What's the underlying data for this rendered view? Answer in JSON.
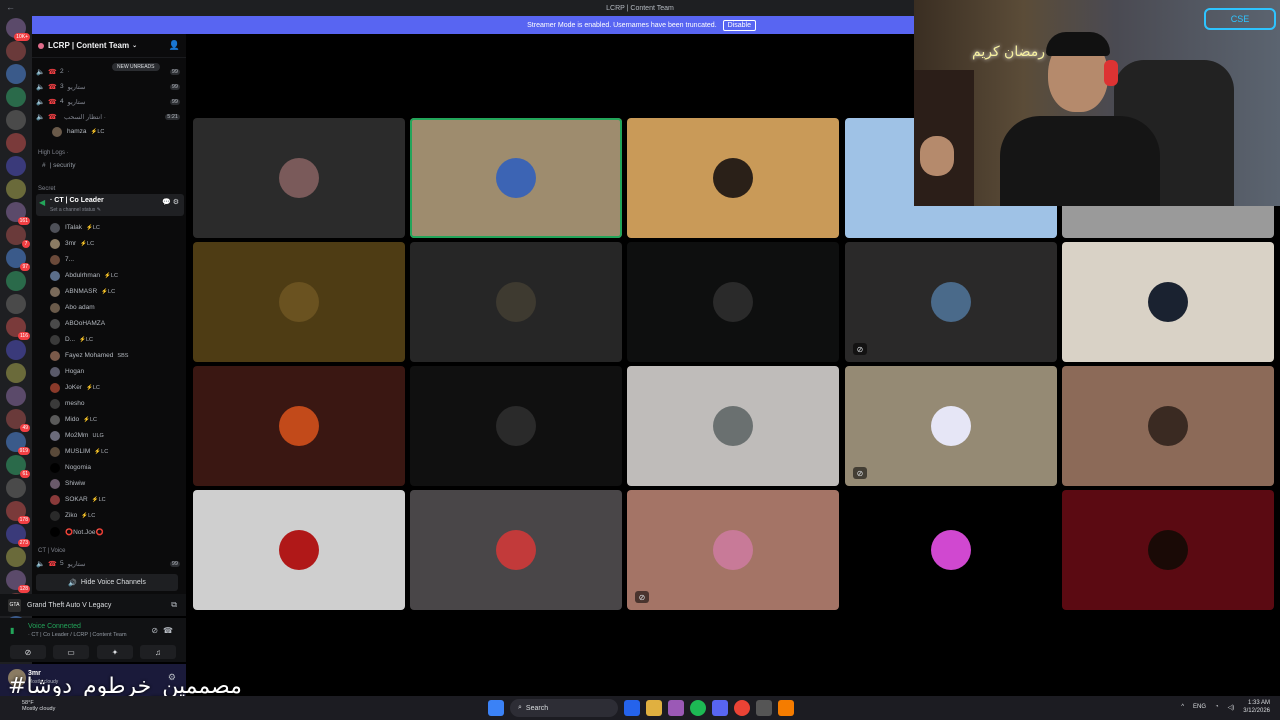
{
  "window": {
    "title": "LCRP | Content Team",
    "back_glyph": "←"
  },
  "banner": {
    "text": "Streamer Mode is enabled. Usernames have been truncated.",
    "button": "Disable"
  },
  "rail": {
    "badges": [
      "10K+",
      "",
      "",
      "",
      "",
      "",
      "",
      "",
      "161",
      "7",
      "97",
      "",
      "",
      "116",
      "",
      "",
      "",
      "49",
      "919",
      "61",
      "",
      "178",
      "273",
      "",
      "128",
      "10",
      "TKG",
      "NEW"
    ]
  },
  "server": {
    "name": "LCRP | Content Team",
    "chevron": "⌄",
    "invite_icon": "👤"
  },
  "channels": {
    "voice_top": [
      {
        "num": "2",
        "label": "·",
        "count": "99"
      },
      {
        "num": "3",
        "label": "ستاريو",
        "count": "99"
      },
      {
        "num": "4",
        "label": "ستاريو",
        "count": "99"
      },
      {
        "num": "",
        "label": "انتظار السحب ·",
        "count": "5:21"
      }
    ],
    "new_unreads": "NEW UNREADS",
    "hamza": {
      "name": "hamza",
      "tag": "⚡LC"
    },
    "high_logs": "High Logs ·",
    "security": "| security",
    "secret": "Secret",
    "active": {
      "title": "· CT | Co Leader",
      "sub": "Set a channel status ✎",
      "actions": "💬⚙"
    },
    "members": [
      {
        "name": "ITalak",
        "tag": "⚡LC",
        "color": "#4e5058"
      },
      {
        "name": "3mr",
        "tag": "⚡LC",
        "color": "#8a7b63"
      },
      {
        "name": "7...",
        "tag": "",
        "color": "#6b4a3a"
      },
      {
        "name": "Abdulrhman",
        "tag": "⚡LC",
        "color": "#5b6e8a"
      },
      {
        "name": "ABNMASR",
        "tag": "⚡LC",
        "color": "#7a6a5a"
      },
      {
        "name": "Abo adam",
        "tag": "",
        "color": "#6a5a4a"
      },
      {
        "name": "ABOoHAMZA",
        "tag": "",
        "color": "#4a4a4a"
      },
      {
        "name": "D...",
        "tag": "⚡LC",
        "color": "#3a3a3a"
      },
      {
        "name": "Fayez Mohamed",
        "tag": "SBS",
        "color": "#7a5a4a"
      },
      {
        "name": "Hogan",
        "tag": "",
        "color": "#5a5a6a"
      },
      {
        "name": "JoKer",
        "tag": "⚡LC",
        "color": "#8a3a2a"
      },
      {
        "name": "mesho",
        "tag": "",
        "color": "#3a3a3a"
      },
      {
        "name": "Mido",
        "tag": "⚡LC",
        "color": "#5a5a5a"
      },
      {
        "name": "Mo2Mm",
        "tag": "ULG",
        "color": "#6a6a7a"
      },
      {
        "name": "MUSLIM",
        "tag": "⚡LC",
        "color": "#5a4a3a"
      },
      {
        "name": "Nogomia",
        "tag": "",
        "color": "#000000"
      },
      {
        "name": "Shiwiw",
        "tag": "",
        "color": "#6a5a6a"
      },
      {
        "name": "SOKAR",
        "tag": "⚡LC",
        "color": "#8a3a3a"
      },
      {
        "name": "Ziko",
        "tag": "⚡LC",
        "color": "#2a2a2a"
      },
      {
        "name": "⭕Not.Joe⭕",
        "tag": "",
        "color": "#000000"
      }
    ],
    "ct_voice": "CT | Voice",
    "voice_bottom": {
      "num": "5",
      "label": "ستاريو",
      "count": "99"
    },
    "hide_voice": "Hide Voice Channels"
  },
  "activity": {
    "icon_text": "GTA",
    "name": "Grand Theft Auto V Legacy"
  },
  "voice": {
    "title": "Voice Connected",
    "sub": "· CT | Co Leader / LCRP | Content Team"
  },
  "user": {
    "name": "3mr",
    "status": "Mostly cloudy"
  },
  "tiles": [
    {
      "bg": "#2b2b2b",
      "ava": "#7a5a5a",
      "muted": false,
      "speaking": false
    },
    {
      "bg": "#9e8c6e",
      "ava": "#3c64b4",
      "muted": false,
      "speaking": true
    },
    {
      "bg": "#c99a58",
      "ava": "#2a2018",
      "muted": false,
      "speaking": false
    },
    {
      "bg": "#9fc2e6",
      "ava": "#9fc2e6",
      "muted": false,
      "speaking": false
    },
    {
      "bg": "#9a9a9a",
      "ava": "#9a9a9a",
      "muted": false,
      "speaking": false
    },
    {
      "bg": "#4e3c14",
      "ava": "#6a5220",
      "muted": false,
      "speaking": false
    },
    {
      "bg": "#262626",
      "ava": "#3e3a30",
      "muted": false,
      "speaking": false
    },
    {
      "bg": "#0e0f0f",
      "ava": "#2a2a2a",
      "muted": false,
      "speaking": false
    },
    {
      "bg": "#2a2929",
      "ava": "#4a6a8a",
      "muted": true,
      "speaking": false
    },
    {
      "bg": "#d9d2c6",
      "ava": "#1a2230",
      "muted": false,
      "speaking": false
    },
    {
      "bg": "#3a1712",
      "ava": "#c24a1a",
      "muted": false,
      "speaking": false
    },
    {
      "bg": "#101010",
      "ava": "#2a2a2a",
      "muted": false,
      "speaking": false
    },
    {
      "bg": "#bfbcba",
      "ava": "#6a7070",
      "muted": false,
      "speaking": false
    },
    {
      "bg": "#958a74",
      "ava": "#e6e6f6",
      "muted": true,
      "speaking": false
    },
    {
      "bg": "#8c6a58",
      "ava": "#3a2a22",
      "muted": false,
      "speaking": false
    },
    {
      "bg": "#cfcfcf",
      "ava": "#b01818",
      "muted": false,
      "speaking": false
    },
    {
      "bg": "#494648",
      "ava": "#c23a3a",
      "muted": false,
      "speaking": false
    },
    {
      "bg": "#a47466",
      "ava": "#c87a98",
      "muted": true,
      "speaking": false
    },
    {
      "bg": "#000000",
      "ava": "#d048d0",
      "muted": false,
      "speaking": false
    },
    {
      "bg": "#5b0a12",
      "ava": "#1a0a06",
      "muted": false,
      "speaking": false
    }
  ],
  "webcam": {
    "sign": "رمضان كريم",
    "neon": "CSE"
  },
  "overlay_text": "#مصممين_خرطوم_دوشا",
  "taskbar": {
    "weather_temp": "58°F",
    "weather_desc": "Mostly cloudy",
    "search": "Search",
    "lang": "ENG",
    "time": "1:33 AM",
    "date": "3/12/2026"
  }
}
